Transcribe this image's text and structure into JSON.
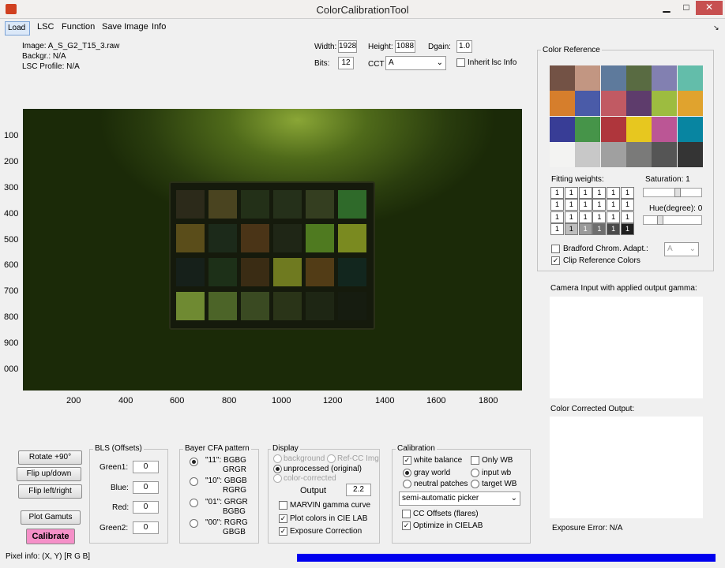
{
  "window": {
    "title": "ColorCalibrationTool",
    "min": "▁",
    "max": "□",
    "close": "✕"
  },
  "menu": [
    "Load",
    "LSC",
    "Function",
    "Save Image",
    "Info"
  ],
  "info": {
    "image": "Image: A_S_G2_T15_3.raw",
    "backgr": "Backgr.: N/A",
    "lsc": "LSC Profile: N/A"
  },
  "params": {
    "width_label": "Width:",
    "width": "1928",
    "height_label": "Height:",
    "height": "1088",
    "dgain_label": "Dgain:",
    "dgain": "1.0",
    "bits_label": "Bits:",
    "bits": "12",
    "cct_label": "CCT",
    "cct": "A",
    "inherit": "Inherit lsc Info"
  },
  "plot": {
    "yticks": [
      "100",
      "200",
      "300",
      "400",
      "500",
      "600",
      "700",
      "800",
      "900",
      "000"
    ],
    "xticks": [
      "200",
      "400",
      "600",
      "800",
      "1000",
      "1200",
      "1400",
      "1600",
      "1800"
    ]
  },
  "chart_patch_colors": [
    "#2c2a1a",
    "#4a4420",
    "#233018",
    "#25301a",
    "#343e20",
    "#2f6a2a",
    "#5a4d1a",
    "#1c2a1a",
    "#4a3417",
    "#1f2616",
    "#4f7a20",
    "#7a8a20",
    "#16201a",
    "#1d3018",
    "#3a2c14",
    "#6f7a20",
    "#523c16",
    "#12261e",
    "#6f8a32",
    "#4c6428",
    "#3a4a22",
    "#2a3418",
    "#1e2614",
    "#161c10"
  ],
  "color_reference": {
    "title": "Color Reference",
    "colors": [
      "#735245",
      "#c29682",
      "#5e7a9c",
      "#596b42",
      "#8280b1",
      "#63bdaa",
      "#d67e2c",
      "#4a5ba8",
      "#c15a63",
      "#5e3c6c",
      "#9dbc40",
      "#e0a32e",
      "#383d96",
      "#469449",
      "#af363c",
      "#e7c71f",
      "#bb5695",
      "#0885a1",
      "#f3f3f2",
      "#c8c8c8",
      "#a0a0a0",
      "#7a7a79",
      "#555555",
      "#343434"
    ]
  },
  "fitting": {
    "title": "Fitting weights:",
    "rows": [
      [
        "1",
        "1",
        "1",
        "1",
        "1",
        "1"
      ],
      [
        "1",
        "1",
        "1",
        "1",
        "1",
        "1"
      ],
      [
        "1",
        "1",
        "1",
        "1",
        "1",
        "1"
      ],
      [
        "1",
        "1",
        "1",
        "1",
        "1",
        "1"
      ]
    ]
  },
  "saturation": "Saturation: 1",
  "hue": "Hue(degree): 0",
  "bradford": "Bradford Chrom. Adapt.:",
  "bradford_value": "A",
  "clip": "Clip Reference Colors",
  "camera_input": "Camera Input with applied output gamma:",
  "corrected_output": "Color Corrected Output:",
  "exposure_error": "Exposure Error: N/A",
  "buttons": {
    "rotate": "Rotate +90°",
    "flip_ud": "Flip up/down",
    "flip_lr": "Flip left/right",
    "plot_gamuts": "Plot Gamuts",
    "calibrate": "Calibrate"
  },
  "bls": {
    "title": "BLS (Offsets)",
    "green1_label": "Green1:",
    "green1": "0",
    "blue_label": "Blue:",
    "blue": "0",
    "red_label": "Red:",
    "red": "0",
    "green2_label": "Green2:",
    "green2": "0"
  },
  "bayer": {
    "title": "Bayer CFA pattern",
    "opts": [
      [
        "\"11\": BGBG",
        "GRGR"
      ],
      [
        "\"10\": GBGB",
        "RGRG"
      ],
      [
        "\"01\": GRGR",
        "BGBG"
      ],
      [
        "\"00\": RGRG",
        "GBGB"
      ]
    ]
  },
  "display": {
    "title": "Display",
    "background": "background",
    "refcc": "Ref-CC Img",
    "unprocessed": "unprocessed (original)",
    "corrected": "color-corrected",
    "output": "Output",
    "output_value": "2.2",
    "marvin": "MARVIN gamma curve",
    "cielab": "Plot colors in CIE LAB",
    "exposure": "Exposure Correction"
  },
  "calibration": {
    "title": "Calibration",
    "wb": "white balance",
    "only_wb": "Only WB",
    "gray": "gray world",
    "input_wb": "input wb",
    "neutral": "neutral patches",
    "target_wb": "target WB",
    "picker": "semi-automatic picker",
    "cc_offsets": "CC Offsets (flares)",
    "optimize": "Optimize in CIELAB"
  },
  "status": {
    "pixel_info": "Pixel info: (X, Y)  [R G B]",
    "progress": 1.0
  },
  "colors": {
    "calibrate_bg": "#f590c8",
    "progress": "#0000ee"
  }
}
